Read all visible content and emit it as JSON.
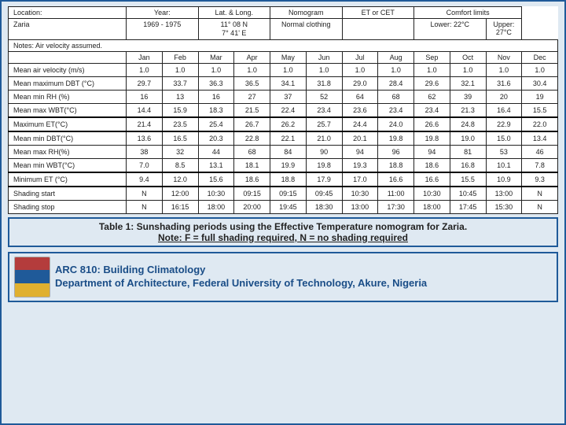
{
  "header": {
    "location_lbl": "Location:",
    "location": "Zaria",
    "year_lbl": "Year:",
    "year": "1969 - 1975",
    "latlong_lbl": "Lat. & Long.",
    "latlong1": "11° 08 N",
    "latlong2": "7° 41' E",
    "nomo_lbl": "Nomogram",
    "nomo": "Normal clothing",
    "et_lbl": "ET or CET",
    "comfort_lbl": "Comfort limits",
    "lower": "Lower: 22°C",
    "upper": "Upper: 27°C",
    "notes": "Notes: Air velocity assumed."
  },
  "months": [
    "Jan",
    "Feb",
    "Mar",
    "Apr",
    "May",
    "Jun",
    "Jul",
    "Aug",
    "Sep",
    "Oct",
    "Nov",
    "Dec"
  ],
  "rows": [
    {
      "k": "air",
      "label": "Mean air velocity (m/s)",
      "v": [
        "1.0",
        "1.0",
        "1.0",
        "1.0",
        "1.0",
        "1.0",
        "1.0",
        "1.0",
        "1.0",
        "1.0",
        "1.0",
        "1.0"
      ]
    },
    {
      "k": "maxdbt",
      "label": "Mean maximum DBT (°C)",
      "v": [
        "29.7",
        "33.7",
        "36.3",
        "36.5",
        "34.1",
        "31.8",
        "29.0",
        "28.4",
        "29.6",
        "32.1",
        "31.6",
        "30.4"
      ]
    },
    {
      "k": "minrh",
      "label": "Mean min RH (%)",
      "v": [
        "16",
        "13",
        "16",
        "27",
        "37",
        "52",
        "64",
        "68",
        "62",
        "39",
        "20",
        "19"
      ]
    },
    {
      "k": "maxwbt",
      "label": "Mean max WBT(°C)",
      "v": [
        "14.4",
        "15.9",
        "18.3",
        "21.5",
        "22.4",
        "23.4",
        "23.6",
        "23.4",
        "23.4",
        "21.3",
        "16.4",
        "15.5"
      ]
    },
    {
      "k": "maxet",
      "label": "Maximum ET(°C)",
      "v": [
        "21.4",
        "23.5",
        "25.4",
        "26.7",
        "26.2",
        "25.7",
        "24.4",
        "24.0",
        "26.6",
        "24.8",
        "22.9",
        "22.0"
      ],
      "box": true
    },
    {
      "k": "mindbt",
      "label": "Mean min DBT(°C)",
      "v": [
        "13.6",
        "16.5",
        "20.3",
        "22.8",
        "22.1",
        "21.0",
        "20.1",
        "19.8",
        "19.8",
        "19.0",
        "15.0",
        "13.4"
      ]
    },
    {
      "k": "maxrh",
      "label": "Mean max RH(%)",
      "v": [
        "38",
        "32",
        "44",
        "68",
        "84",
        "90",
        "94",
        "96",
        "94",
        "81",
        "53",
        "46"
      ]
    },
    {
      "k": "minwbt",
      "label": "Mean min WBT(°C)",
      "v": [
        "7.0",
        "8.5",
        "13.1",
        "18.1",
        "19.9",
        "19.8",
        "19.3",
        "18.8",
        "18.6",
        "16.8",
        "10.1",
        "7.8"
      ]
    },
    {
      "k": "minet",
      "label": "Minimum ET (°C)",
      "v": [
        "9.4",
        "12.0",
        "15.6",
        "18.6",
        "18.8",
        "17.9",
        "17.0",
        "16.6",
        "16.6",
        "15.5",
        "10.9",
        "9.3"
      ],
      "box": true
    },
    {
      "k": "shstart",
      "label": "Shading start",
      "v": [
        "N",
        "12:00",
        "10:30",
        "09:15",
        "09:15",
        "09:45",
        "10:30",
        "11:00",
        "10:30",
        "10:45",
        "13:00",
        "N"
      ]
    },
    {
      "k": "shstop",
      "label": "Shading stop",
      "v": [
        "N",
        "16:15",
        "18:00",
        "20:00",
        "19:45",
        "18:30",
        "13:00",
        "17:30",
        "18:00",
        "17:45",
        "15:30",
        "N"
      ]
    }
  ],
  "caption": {
    "title": "Table 1: Sunshading periods using the Effective Temperature nomogram for Zaria.",
    "note": "Note: F = full shading required, N = no shading required"
  },
  "footer": {
    "line1": "ARC 810: Building Climatology",
    "line2": "Department of Architecture, Federal University of Technology, Akure, Nigeria"
  }
}
